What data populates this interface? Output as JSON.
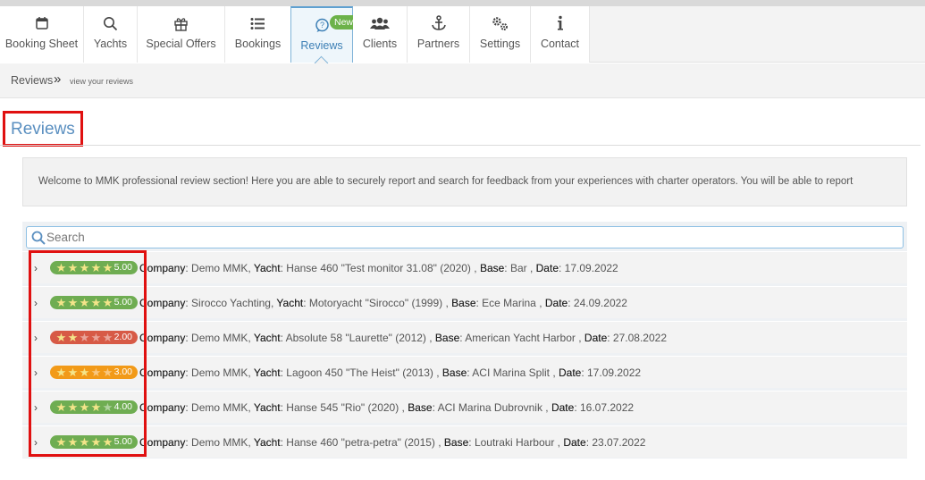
{
  "nav": {
    "items": [
      {
        "label": "Booking Sheet",
        "icon": "calendar-icon"
      },
      {
        "label": "Yachts",
        "icon": "search-icon"
      },
      {
        "label": "Special Offers",
        "icon": "gift-icon"
      },
      {
        "label": "Bookings",
        "icon": "list-icon"
      },
      {
        "label": "Reviews",
        "icon": "chat-icon",
        "badge": "New!"
      },
      {
        "label": "Clients",
        "icon": "users-icon"
      },
      {
        "label": "Partners",
        "icon": "anchor-icon"
      },
      {
        "label": "Settings",
        "icon": "gears-icon"
      },
      {
        "label": "Contact",
        "icon": "info-icon"
      }
    ]
  },
  "breadcrumb": {
    "main": "Reviews",
    "separator": "»",
    "sub": "view your reviews"
  },
  "page": {
    "title": "Reviews",
    "welcome": "Welcome to MMK professional review section! Here you are able to securely report and search for feedback from your experiences with charter operators. You will be able to report"
  },
  "search": {
    "placeholder": "Search"
  },
  "labels": {
    "company": "Company",
    "yacht": "Yacht",
    "base": "Base",
    "date": "Date"
  },
  "colors": {
    "accent": "#5a8fc0",
    "green": "#6fad52",
    "red": "#d75a46",
    "orange": "#f29a18",
    "highlight": "#e01010"
  },
  "reviews": [
    {
      "rating": 5,
      "score": "5.00",
      "color": "green",
      "company": "Demo MMK",
      "yacht": "Hanse 460 \"Test monitor 31.08\" (2020)",
      "base": "Bar",
      "date": "17.09.2022"
    },
    {
      "rating": 5,
      "score": "5.00",
      "color": "green",
      "company": "Sirocco Yachting",
      "yacht": "Motoryacht \"Sirocco\" (1999)",
      "base": "Ece Marina",
      "date": "24.09.2022"
    },
    {
      "rating": 2,
      "score": "2.00",
      "color": "red",
      "company": "Demo MMK",
      "yacht": "Absolute 58 \"Laurette\" (2012)",
      "base": "American Yacht Harbor",
      "date": "27.08.2022"
    },
    {
      "rating": 3,
      "score": "3.00",
      "color": "orange",
      "company": "Demo MMK",
      "yacht": "Lagoon 450 \"The Heist\" (2013)",
      "base": "ACI Marina Split",
      "date": "17.09.2022"
    },
    {
      "rating": 4,
      "score": "4.00",
      "color": "green",
      "company": "Demo MMK",
      "yacht": "Hanse 545 \"Rio\" (2020)",
      "base": "ACI Marina Dubrovnik",
      "date": "16.07.2022"
    },
    {
      "rating": 5,
      "score": "5.00",
      "color": "green",
      "company": "Demo MMK",
      "yacht": "Hanse 460 \"petra-petra\" (2015)",
      "base": "Loutraki Harbour",
      "date": "23.07.2022"
    }
  ]
}
